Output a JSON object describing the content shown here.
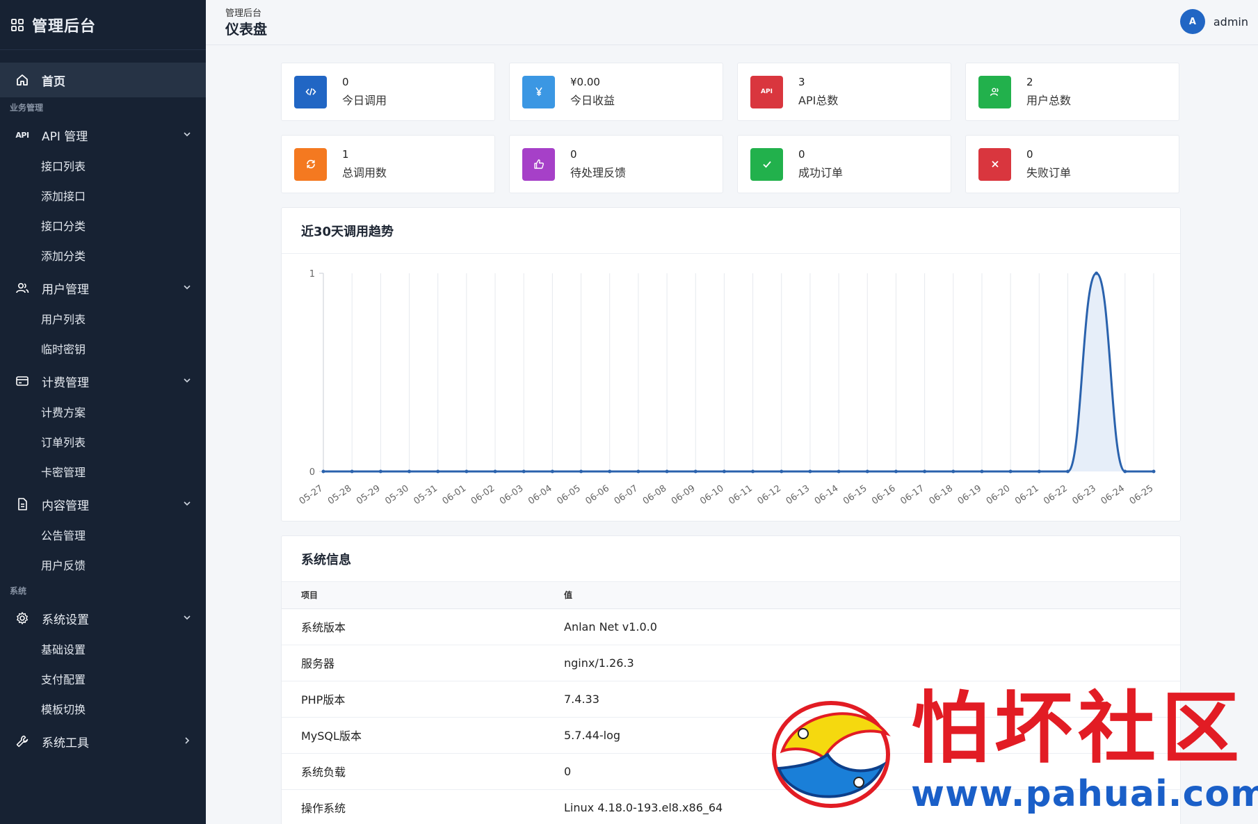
{
  "brand": {
    "title": "管理后台",
    "icon": "grid-icon"
  },
  "sidebar": {
    "home": {
      "label": "首页",
      "icon": "home-icon"
    },
    "section_business": "业务管理",
    "section_system": "系统",
    "groups": [
      {
        "label": "API 管理",
        "icon": "api-icon",
        "icon_text": "API",
        "items": [
          "接口列表",
          "添加接口",
          "接口分类",
          "添加分类"
        ]
      },
      {
        "label": "用户管理",
        "icon": "users-icon",
        "items": [
          "用户列表",
          "临时密钥"
        ]
      },
      {
        "label": "计费管理",
        "icon": "card-icon",
        "items": [
          "计费方案",
          "订单列表",
          "卡密管理"
        ]
      },
      {
        "label": "内容管理",
        "icon": "document-icon",
        "items": [
          "公告管理",
          "用户反馈"
        ]
      },
      {
        "label": "系统设置",
        "icon": "gear-icon",
        "items": [
          "基础设置",
          "支付配置",
          "模板切换"
        ]
      },
      {
        "label": "系统工具",
        "icon": "tools-icon",
        "items": []
      }
    ]
  },
  "header": {
    "breadcrumb": "管理后台",
    "title": "仪表盘",
    "avatar_letter": "A",
    "username": "admin"
  },
  "stats": [
    {
      "value": "0",
      "label": "今日调用",
      "icon": "code-icon",
      "color": "#2166c4"
    },
    {
      "value": "¥0.00",
      "label": "今日收益",
      "icon": "yen-icon",
      "color": "#3b97e3"
    },
    {
      "value": "3",
      "label": "API总数",
      "icon": "api-badge-icon",
      "icon_text": "API",
      "color": "#d9363e"
    },
    {
      "value": "2",
      "label": "用户总数",
      "icon": "users-icon",
      "color": "#22b14c"
    },
    {
      "value": "1",
      "label": "总调用数",
      "icon": "refresh-icon",
      "color": "#f47920"
    },
    {
      "value": "0",
      "label": "待处理反馈",
      "icon": "thumbs-up-icon",
      "color": "#a640c8"
    },
    {
      "value": "0",
      "label": "成功订单",
      "icon": "check-icon",
      "color": "#22b14c"
    },
    {
      "value": "0",
      "label": "失败订单",
      "icon": "close-icon",
      "color": "#d9363e"
    }
  ],
  "chart_card_title": "近30天调用趋势",
  "chart_data": {
    "type": "area",
    "title": "",
    "xlabel": "",
    "ylabel": "",
    "x": [
      "05-27",
      "05-28",
      "05-29",
      "05-30",
      "05-31",
      "06-01",
      "06-02",
      "06-03",
      "06-04",
      "06-05",
      "06-06",
      "06-07",
      "06-08",
      "06-09",
      "06-10",
      "06-11",
      "06-12",
      "06-13",
      "06-14",
      "06-15",
      "06-16",
      "06-17",
      "06-18",
      "06-19",
      "06-20",
      "06-21",
      "06-22",
      "06-23",
      "06-24",
      "06-25"
    ],
    "series": [
      {
        "values": [
          0,
          0,
          0,
          0,
          0,
          0,
          0,
          0,
          0,
          0,
          0,
          0,
          0,
          0,
          0,
          0,
          0,
          0,
          0,
          0,
          0,
          0,
          0,
          0,
          0,
          0,
          0,
          1,
          0,
          0
        ]
      }
    ],
    "ylim": [
      0,
      1
    ],
    "yticks": [
      "0",
      "1"
    ],
    "grid": true,
    "line_color": "#2a62ad",
    "fill_color": "#e6eef9"
  },
  "system_info": {
    "title": "系统信息",
    "headers": [
      "项目",
      "值"
    ],
    "rows": [
      [
        "系统版本",
        "Anlan Net v1.0.0"
      ],
      [
        "服务器",
        "nginx/1.26.3"
      ],
      [
        "PHP版本",
        "7.4.33"
      ],
      [
        "MySQL版本",
        "5.7.44-log"
      ],
      [
        "系统负载",
        "0"
      ],
      [
        "操作系统",
        "Linux 4.18.0-193.el8.x86_64"
      ]
    ]
  },
  "watermark": {
    "text": "怕坏社区",
    "url": "www.pahuai.com",
    "icon": "fish-logo-icon"
  }
}
